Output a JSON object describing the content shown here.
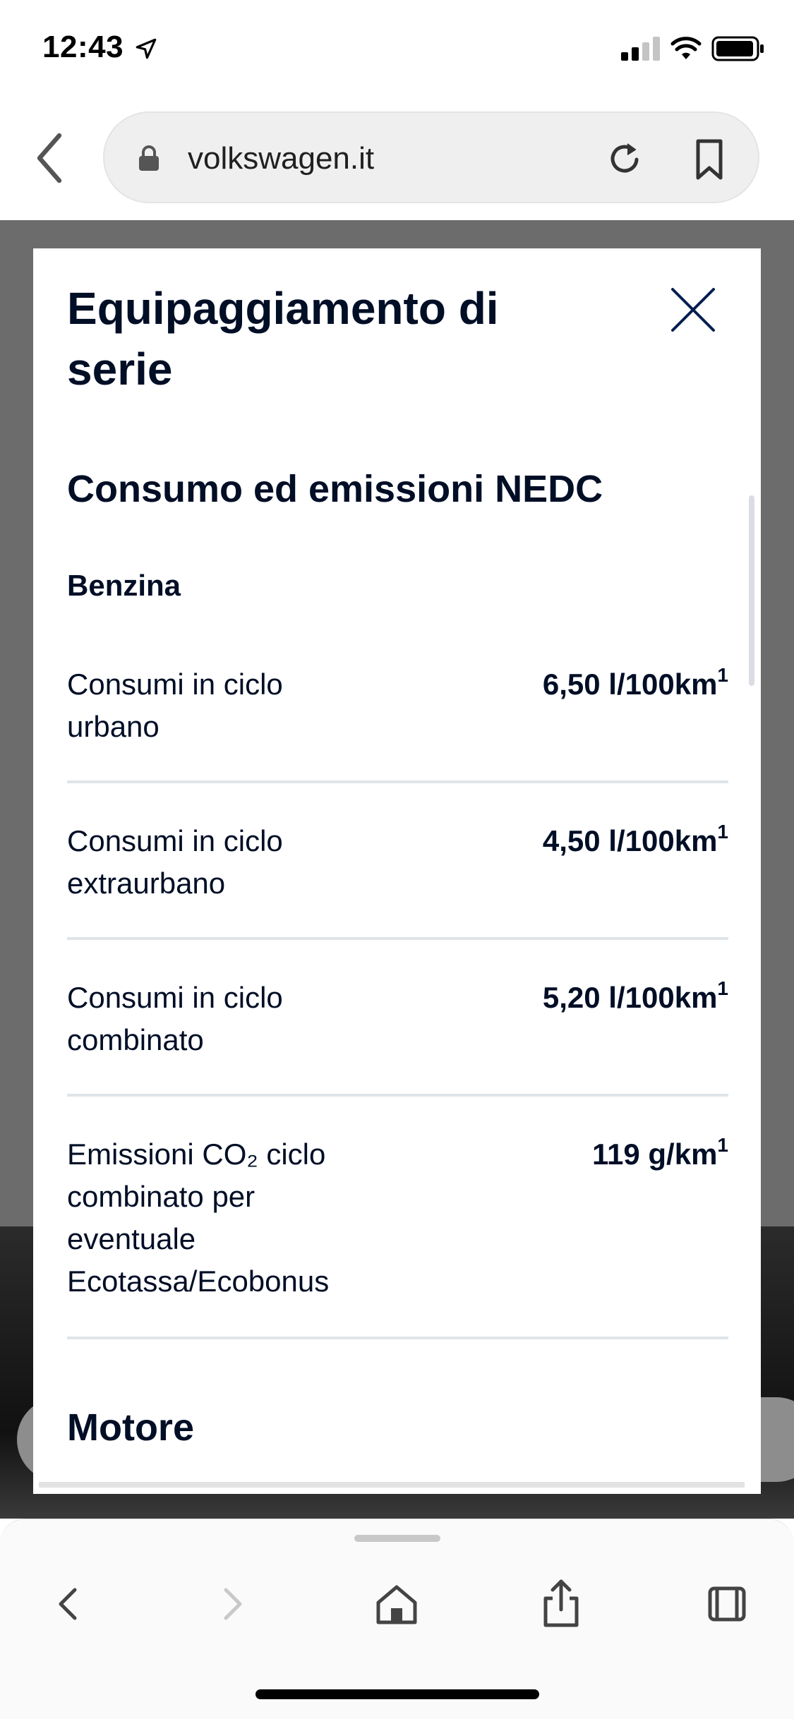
{
  "status_bar": {
    "time": "12:43"
  },
  "browser": {
    "url": "volkswagen.it"
  },
  "modal": {
    "title": "Equipaggiamento di serie",
    "section_title": "Consumo ed emissioni NEDC",
    "fuel_type": "Benzina",
    "rows": [
      {
        "label": "Consumi in ciclo urbano",
        "value": "6,50 l/100km",
        "note": "1"
      },
      {
        "label": "Consumi in ciclo extraurbano",
        "value": "4,50 l/100km",
        "note": "1"
      },
      {
        "label": "Consumi in ciclo combinato",
        "value": "5,20 l/100km",
        "note": "1"
      },
      {
        "label": "Emissioni CO₂ ciclo combinato per eventuale Ecotassa/Ecobonus",
        "value": "119 g/km",
        "note": "1"
      }
    ],
    "next_section_title": "Motore"
  },
  "icons": {
    "location": "location-arrow-icon",
    "signal": "cellular-signal-icon",
    "wifi": "wifi-icon",
    "battery": "battery-icon",
    "lock": "lock-icon",
    "reload": "reload-icon",
    "bookmark": "bookmark-icon",
    "close": "close-icon",
    "back": "chevron-left-icon",
    "forward": "chevron-right-icon",
    "home": "home-icon",
    "share": "share-icon",
    "tabs": "tabs-icon"
  },
  "colors": {
    "text_primary": "#000e26",
    "close_icon": "#001e50",
    "overlay": "#6c6c6c"
  }
}
